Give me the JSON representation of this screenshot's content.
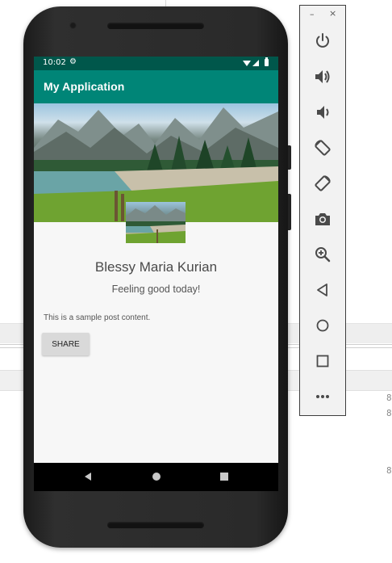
{
  "status_bar": {
    "time": "10:02",
    "gear_icon": "gear-icon",
    "wifi_icon": "wifi-icon",
    "signal_icon": "signal-icon",
    "battery_icon": "battery-icon"
  },
  "app_bar": {
    "title": "My Application"
  },
  "profile": {
    "name": "Blessy Maria Kurian",
    "status": "Feeling good today!"
  },
  "post": {
    "content": "This is a sample post content.",
    "share_label": "SHARE"
  },
  "nav": {
    "back_icon": "back-triangle-icon",
    "home_icon": "home-circle-icon",
    "recents_icon": "recents-square-icon"
  },
  "emulator": {
    "minimize_label": "–",
    "close_label": "×",
    "buttons": [
      "power-icon",
      "volume-up-icon",
      "volume-down-icon",
      "rotate-left-icon",
      "rotate-right-icon",
      "camera-icon",
      "zoom-icon",
      "back-icon",
      "home-icon",
      "overview-icon",
      "more-icon"
    ]
  },
  "background": {
    "glyph_a": "8",
    "glyph_b": "8",
    "glyph_c": "8"
  },
  "colors": {
    "app_bar": "#008577",
    "status_bar": "#00574b",
    "emulator_icon": "#4a4a4a"
  }
}
